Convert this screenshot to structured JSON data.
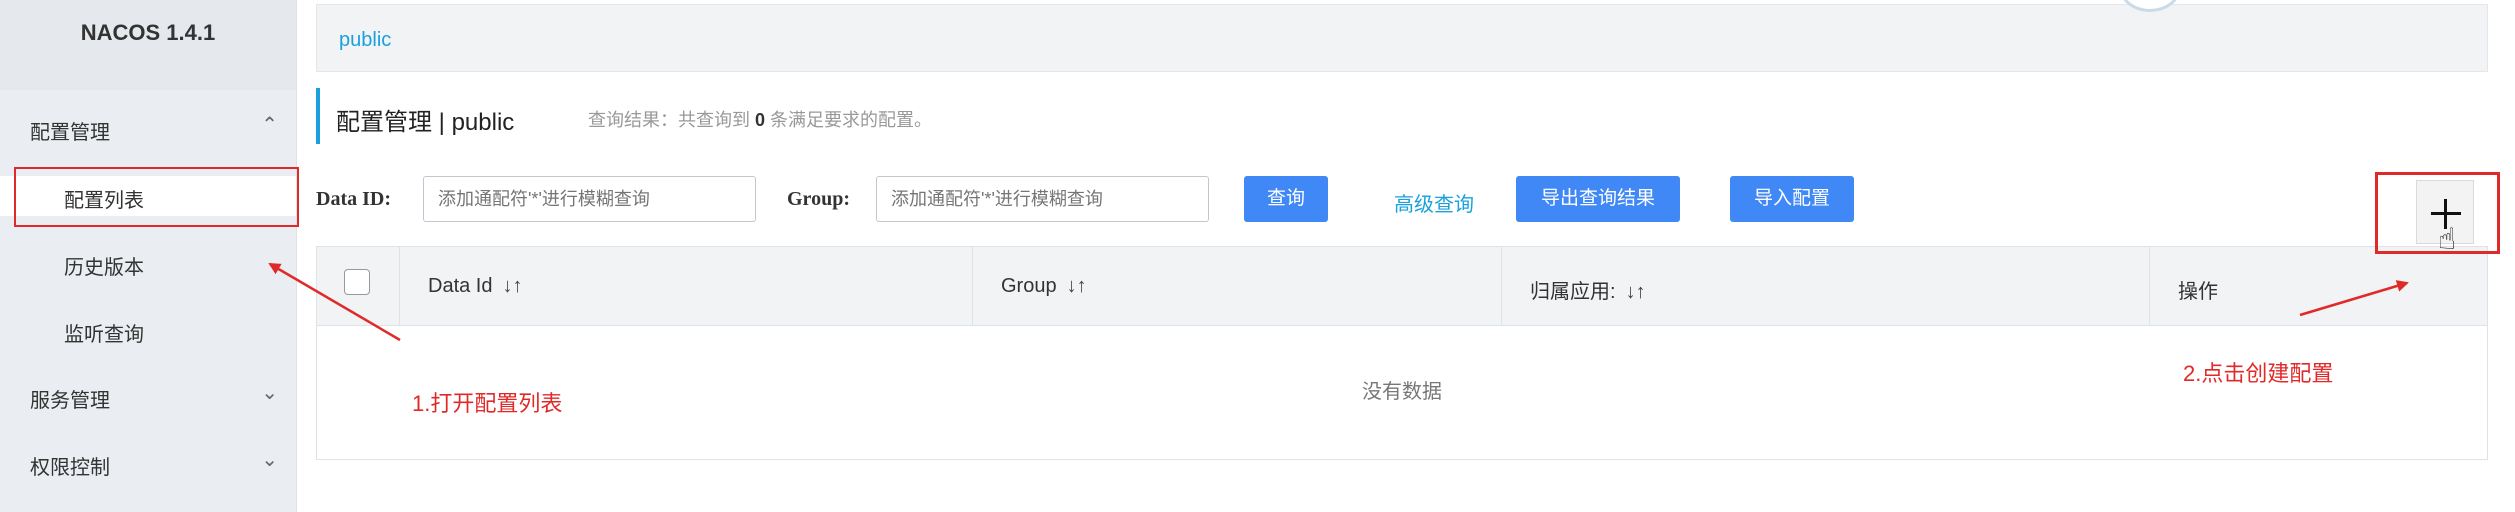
{
  "app": {
    "logo": "NACOS 1.4.1"
  },
  "sidebar": {
    "groups": [
      {
        "label": "配置管理",
        "chevron": "^"
      },
      {
        "label": "服务管理",
        "chevron": "v"
      },
      {
        "label": "权限控制",
        "chevron": "v"
      }
    ],
    "items": [
      {
        "label": "配置列表"
      },
      {
        "label": "历史版本"
      },
      {
        "label": "监听查询"
      }
    ]
  },
  "breadcrumb": {
    "namespace": "public"
  },
  "page": {
    "title": "配置管理  |  public",
    "result_prefix": "查询结果：共查询到 ",
    "result_count": "0",
    "result_suffix": " 条满足要求的配置。"
  },
  "search": {
    "data_id_label": "Data ID:",
    "data_id_placeholder": "添加通配符'*'进行模糊查询",
    "group_label": "Group:",
    "group_placeholder": "添加通配符'*'进行模糊查询",
    "query_button": "查询",
    "advanced_link": "高级查询",
    "export_button": "导出查询结果",
    "import_button": "导入配置"
  },
  "table": {
    "columns": [
      "Data Id",
      "Group",
      "归属应用:",
      "操作"
    ],
    "sort_glyph": "↓↑",
    "empty_text": "没有数据"
  },
  "annotations": {
    "step1": "1.打开配置列表",
    "step2": "2.点击创建配置"
  },
  "colors": {
    "accent": "#1aa0dc",
    "primary_button": "#3f88f5",
    "annotation_red": "#e02a2a"
  }
}
